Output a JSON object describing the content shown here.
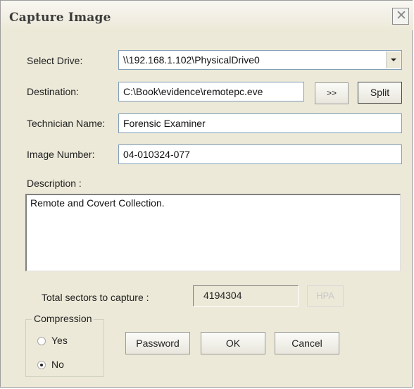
{
  "window": {
    "title": "Capture Image",
    "close_glyph": "✕"
  },
  "labels": {
    "select_drive": "Select Drive:",
    "destination": "Destination:",
    "technician": "Technician Name:",
    "image_number": "Image Number:",
    "description": "Description :",
    "total_sectors": "Total sectors to capture :"
  },
  "fields": {
    "drive": "\\\\192.168.1.102\\PhysicalDrive0",
    "destination": "C:\\Book\\evidence\\remotepc.eve",
    "technician": "Forensic Examiner",
    "image_number": "04-010324-077",
    "description": "Remote and Covert Collection.",
    "sectors": "4194304"
  },
  "buttons": {
    "browse": ">>",
    "split": "Split",
    "hpa": "HPA",
    "password": "Password",
    "ok": "OK",
    "cancel": "Cancel"
  },
  "compression": {
    "title": "Compression",
    "yes": "Yes",
    "no": "No",
    "selected": "No"
  },
  "icons": {
    "close": "close-icon",
    "dropdown": "chevron-down-icon"
  }
}
